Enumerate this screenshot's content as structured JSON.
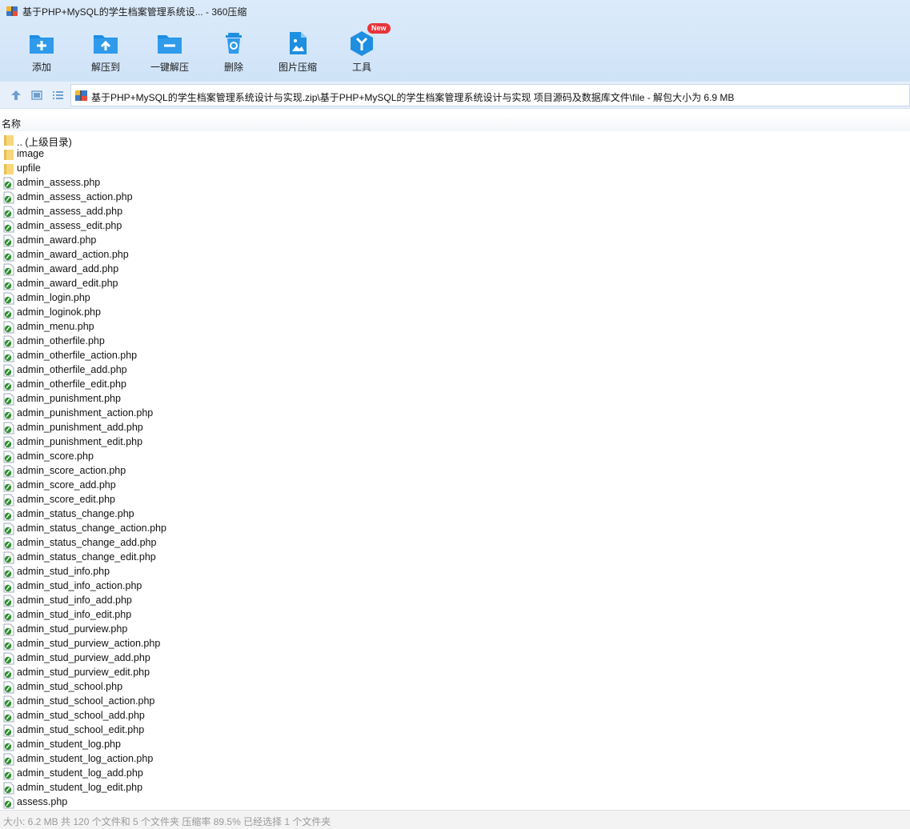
{
  "window": {
    "title": "基于PHP+MySQL的学生档案管理系统设... - 360压缩"
  },
  "toolbar": {
    "items": [
      {
        "label": "添加",
        "icon": "add-folder-icon"
      },
      {
        "label": "解压到",
        "icon": "extract-to-icon"
      },
      {
        "label": "一键解压",
        "icon": "one-click-extract-icon"
      },
      {
        "label": "删除",
        "icon": "recycle-delete-icon"
      },
      {
        "label": "图片压缩",
        "icon": "image-compress-icon"
      },
      {
        "label": "工具",
        "icon": "tools-cube-icon",
        "badge": "New"
      }
    ]
  },
  "navigation": {
    "path": "基于PHP+MySQL的学生档案管理系统设计与实现.zip\\基于PHP+MySQL的学生档案管理系统设计与实现 项目源码及数据库文件\\file - 解包大小为 6.9 MB"
  },
  "list": {
    "column_name": "名称",
    "items": [
      {
        "name": ".. (上级目录)",
        "type": "up"
      },
      {
        "name": "image",
        "type": "folder"
      },
      {
        "name": "upfile",
        "type": "folder"
      },
      {
        "name": "admin_assess.php",
        "type": "php"
      },
      {
        "name": "admin_assess_action.php",
        "type": "php"
      },
      {
        "name": "admin_assess_add.php",
        "type": "php"
      },
      {
        "name": "admin_assess_edit.php",
        "type": "php"
      },
      {
        "name": "admin_award.php",
        "type": "php"
      },
      {
        "name": "admin_award_action.php",
        "type": "php"
      },
      {
        "name": "admin_award_add.php",
        "type": "php"
      },
      {
        "name": "admin_award_edit.php",
        "type": "php"
      },
      {
        "name": "admin_login.php",
        "type": "php"
      },
      {
        "name": "admin_loginok.php",
        "type": "php"
      },
      {
        "name": "admin_menu.php",
        "type": "php"
      },
      {
        "name": "admin_otherfile.php",
        "type": "php"
      },
      {
        "name": "admin_otherfile_action.php",
        "type": "php"
      },
      {
        "name": "admin_otherfile_add.php",
        "type": "php"
      },
      {
        "name": "admin_otherfile_edit.php",
        "type": "php"
      },
      {
        "name": "admin_punishment.php",
        "type": "php"
      },
      {
        "name": "admin_punishment_action.php",
        "type": "php"
      },
      {
        "name": "admin_punishment_add.php",
        "type": "php"
      },
      {
        "name": "admin_punishment_edit.php",
        "type": "php"
      },
      {
        "name": "admin_score.php",
        "type": "php"
      },
      {
        "name": "admin_score_action.php",
        "type": "php"
      },
      {
        "name": "admin_score_add.php",
        "type": "php"
      },
      {
        "name": "admin_score_edit.php",
        "type": "php"
      },
      {
        "name": "admin_status_change.php",
        "type": "php"
      },
      {
        "name": "admin_status_change_action.php",
        "type": "php"
      },
      {
        "name": "admin_status_change_add.php",
        "type": "php"
      },
      {
        "name": "admin_status_change_edit.php",
        "type": "php"
      },
      {
        "name": "admin_stud_info.php",
        "type": "php"
      },
      {
        "name": "admin_stud_info_action.php",
        "type": "php"
      },
      {
        "name": "admin_stud_info_add.php",
        "type": "php"
      },
      {
        "name": "admin_stud_info_edit.php",
        "type": "php"
      },
      {
        "name": "admin_stud_purview.php",
        "type": "php"
      },
      {
        "name": "admin_stud_purview_action.php",
        "type": "php"
      },
      {
        "name": "admin_stud_purview_add.php",
        "type": "php"
      },
      {
        "name": "admin_stud_purview_edit.php",
        "type": "php"
      },
      {
        "name": "admin_stud_school.php",
        "type": "php"
      },
      {
        "name": "admin_stud_school_action.php",
        "type": "php"
      },
      {
        "name": "admin_stud_school_add.php",
        "type": "php"
      },
      {
        "name": "admin_stud_school_edit.php",
        "type": "php"
      },
      {
        "name": "admin_student_log.php",
        "type": "php"
      },
      {
        "name": "admin_student_log_action.php",
        "type": "php"
      },
      {
        "name": "admin_student_log_add.php",
        "type": "php"
      },
      {
        "name": "admin_student_log_edit.php",
        "type": "php"
      },
      {
        "name": "assess.php",
        "type": "php"
      }
    ]
  },
  "status": {
    "text": "大小: 6.2 MB 共 120 个文件和 5 个文件夹 压缩率 89.5% 已经选择 1 个文件夹"
  },
  "colors": {
    "toolbar_bg": "#d5e7f9",
    "icon_blue": "#1e8fe0",
    "badge_red": "#e8333a"
  }
}
